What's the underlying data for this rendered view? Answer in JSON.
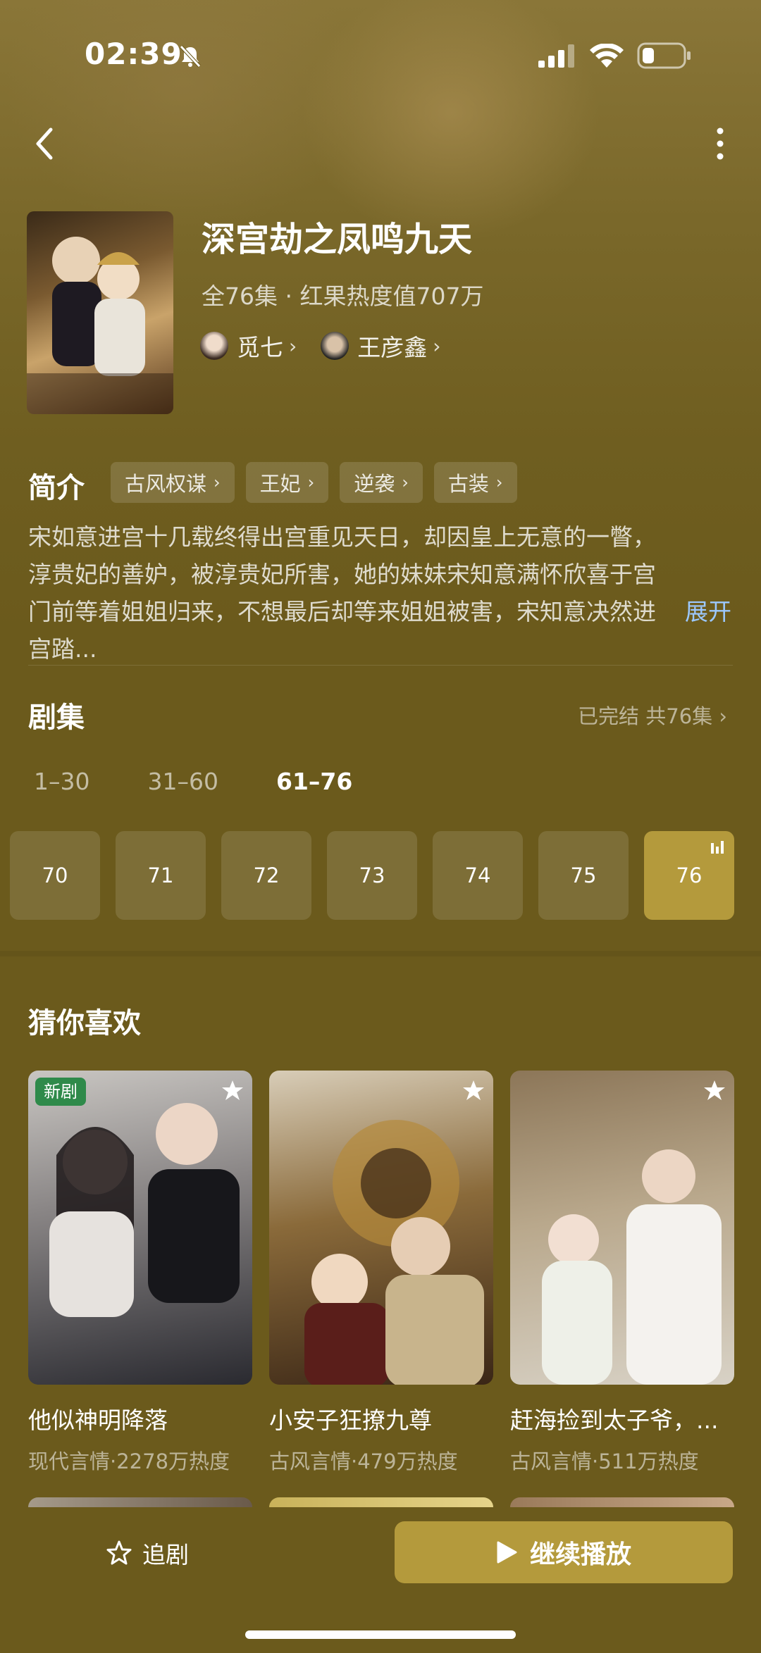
{
  "status_bar": {
    "time": "02:39"
  },
  "header": {
    "title": "深宫劫之凤鸣九天",
    "meta": "全76集 · 红果热度值707万",
    "cast": [
      {
        "name": "觅七"
      },
      {
        "name": "王彦鑫"
      }
    ]
  },
  "intro": {
    "label": "简介",
    "tags": [
      "古风权谋",
      "王妃",
      "逆袭",
      "古装"
    ],
    "synopsis": "宋如意进宫十几载终得出宫重见天日，却因皇上无意的一瞥，淳贵妃的善妒，被淳贵妃所害，她的妹妹宋知意满怀欣喜于宫门前等着姐姐归来，不想最后却等来姐姐被害，宋知意决然进宫踏...",
    "expand_label": "展开"
  },
  "episodes": {
    "label": "剧集",
    "status": "已完结 共76集",
    "ranges": [
      "1–30",
      "31–60",
      "61–76"
    ],
    "active_range": "61–76",
    "items": [
      "70",
      "71",
      "72",
      "73",
      "74",
      "75",
      "76"
    ],
    "current": "76"
  },
  "recommendations": {
    "label": "猜你喜欢",
    "items": [
      {
        "title": "他似神明降落",
        "subtitle": "现代言情·2278万热度",
        "badge": "新剧"
      },
      {
        "title": "小安子狂撩九尊",
        "subtitle": "古风言情·479万热度",
        "badge": ""
      },
      {
        "title": "赶海捡到太子爷，...",
        "subtitle": "古风言情·511万热度",
        "badge": ""
      }
    ]
  },
  "bottom_bar": {
    "follow_label": "追剧",
    "play_label": "继续播放"
  },
  "icons": {
    "back": "chevron-left-icon",
    "more": "more-vertical-icon",
    "follow": "star-outline-icon",
    "play": "play-icon",
    "favorite": "star-filled-icon"
  },
  "colors": {
    "background": "#6b5a1c",
    "accent": "#b49a3c",
    "expand_link": "#9cc8ff",
    "new_badge": "#2f8a4a"
  }
}
